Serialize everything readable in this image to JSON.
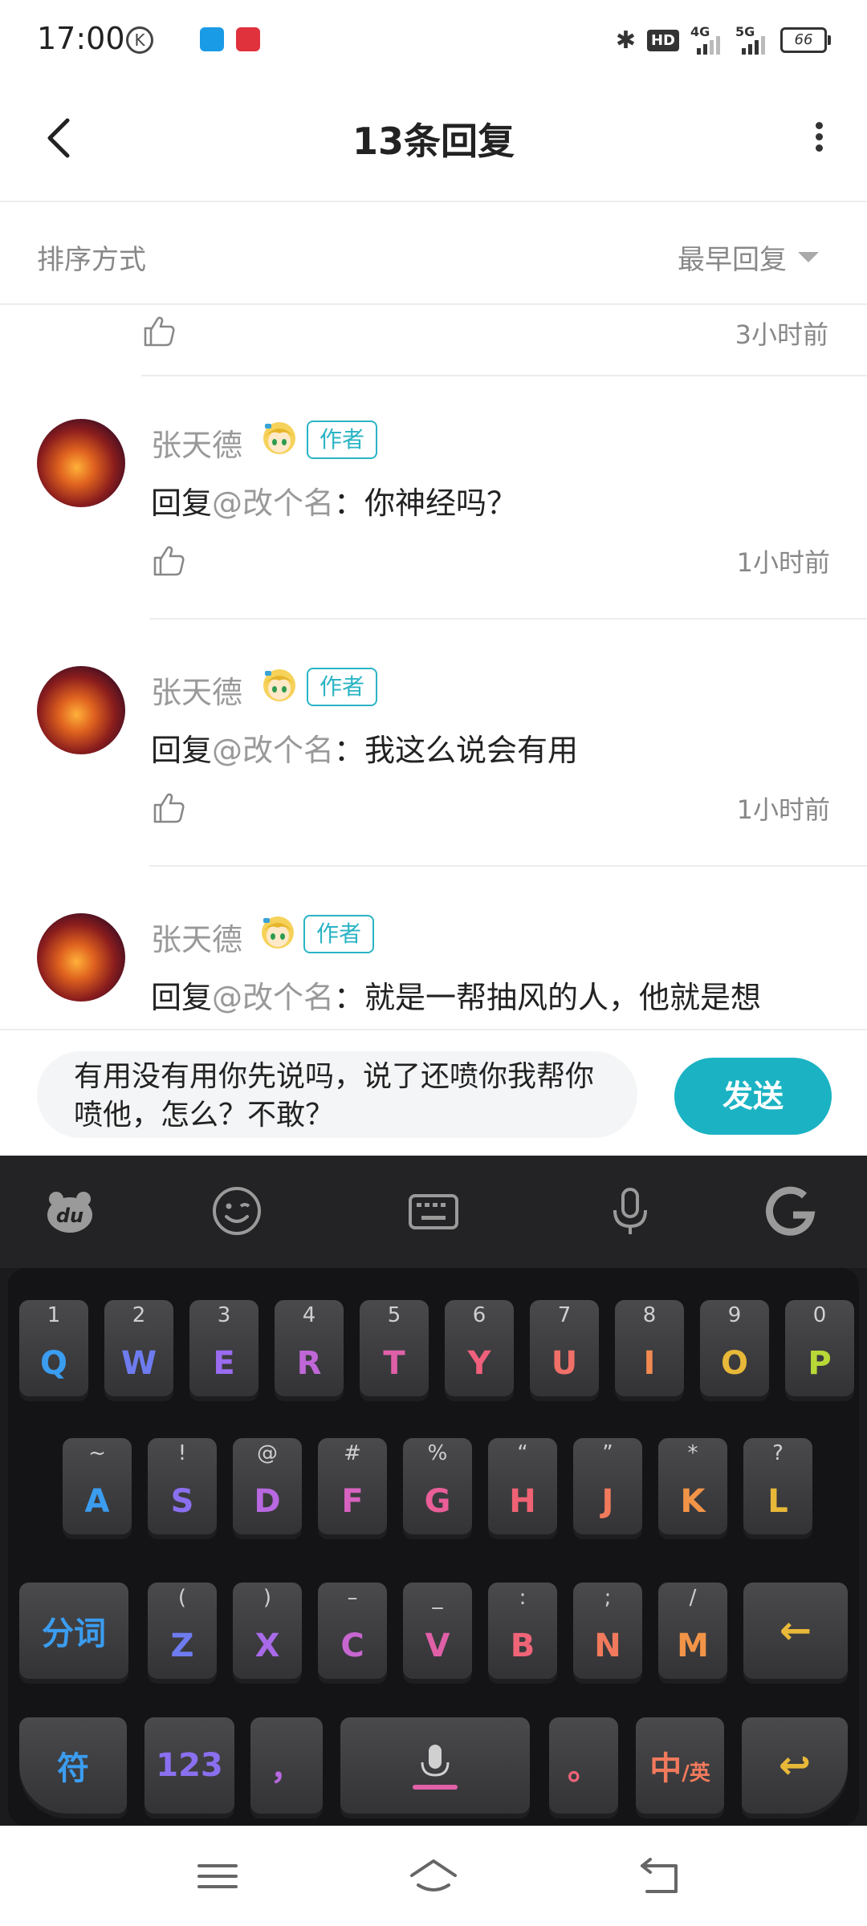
{
  "status_bar": {
    "time": "17:00",
    "k_label": "K",
    "hd_label": "HD",
    "net1": "4G",
    "net2": "5G",
    "battery": "66"
  },
  "header": {
    "title": "13条回复"
  },
  "sort": {
    "label": "排序方式",
    "value": "最早回复"
  },
  "partial_comment": {
    "time": "3小时前"
  },
  "comments": [
    {
      "name": "张天德",
      "badge": "作者",
      "reply_prefix": "回复",
      "reply_target": "@改个名",
      "reply_text": "：你神经吗？",
      "time": "1小时前"
    },
    {
      "name": "张天德",
      "badge": "作者",
      "reply_prefix": "回复",
      "reply_target": "@改个名",
      "reply_text": "：我这么说会有用",
      "time": "1小时前"
    },
    {
      "name": "张天德",
      "badge": "作者",
      "reply_prefix": "回复",
      "reply_target": "@改个名",
      "reply_text": "：就是一帮抽风的人，他就是想",
      "time": ""
    }
  ],
  "input": {
    "text": "有用没有用你先说吗，说了还喷你我帮你喷他，怎么？不敢？",
    "send_label": "发送"
  },
  "keyboard": {
    "row1": [
      {
        "k": "Q",
        "s": "1",
        "c": "#3b9df0"
      },
      {
        "k": "W",
        "s": "2",
        "c": "#6e7cf0"
      },
      {
        "k": "E",
        "s": "3",
        "c": "#9a6cf0"
      },
      {
        "k": "R",
        "s": "4",
        "c": "#c067d8"
      },
      {
        "k": "T",
        "s": "5",
        "c": "#e060a8"
      },
      {
        "k": "Y",
        "s": "6",
        "c": "#f0607c"
      },
      {
        "k": "U",
        "s": "7",
        "c": "#f07068"
      },
      {
        "k": "I",
        "s": "8",
        "c": "#f28a50"
      },
      {
        "k": "O",
        "s": "9",
        "c": "#e8b838"
      },
      {
        "k": "P",
        "s": "0",
        "c": "#b8d838"
      }
    ],
    "row2": [
      {
        "k": "A",
        "s": "~",
        "c": "#3b9df0"
      },
      {
        "k": "S",
        "s": "!",
        "c": "#8a70f0"
      },
      {
        "k": "D",
        "s": "@",
        "c": "#b868e0"
      },
      {
        "k": "F",
        "s": "#",
        "c": "#d862c0"
      },
      {
        "k": "G",
        "s": "%",
        "c": "#ea5e98"
      },
      {
        "k": "H",
        "s": "“",
        "c": "#f06274"
      },
      {
        "k": "J",
        "s": "”",
        "c": "#f27a5c"
      },
      {
        "k": "K",
        "s": "*",
        "c": "#f29448"
      },
      {
        "k": "L",
        "s": "?",
        "c": "#e8b838"
      }
    ],
    "row3": [
      {
        "k": "Z",
        "s": "(",
        "c": "#6e7cf0"
      },
      {
        "k": "X",
        "s": ")",
        "c": "#a86ae8"
      },
      {
        "k": "C",
        "s": "–",
        "c": "#c866d0"
      },
      {
        "k": "V",
        "s": "_",
        "c": "#e060a8"
      },
      {
        "k": "B",
        "s": ":",
        "c": "#f06478"
      },
      {
        "k": "N",
        "s": ";",
        "c": "#f27a5c"
      },
      {
        "k": "M",
        "s": "/",
        "c": "#f29448"
      }
    ],
    "fenci": "分词",
    "backspace_glyph": "←",
    "fu": "符",
    "num": "123",
    "comma": "，",
    "period": "。",
    "lang_main": "中",
    "lang_sub": "/英",
    "enter_glyph": "↩"
  },
  "colors": {
    "accent": "#1bb3c3",
    "author_badge": "#2ab4c4"
  }
}
